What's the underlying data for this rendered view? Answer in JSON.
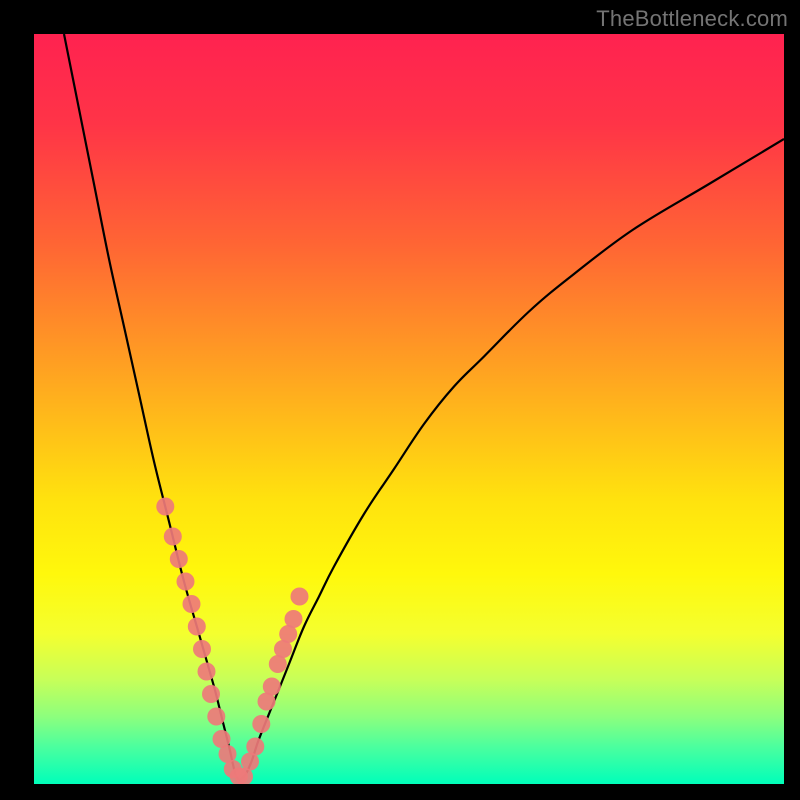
{
  "watermark": "TheBottleneck.com",
  "colors": {
    "frame": "#000000",
    "curve": "#000000",
    "point_fill": "#ee7a79",
    "gradient_stops": [
      {
        "offset": 0.0,
        "color": "#ff2250"
      },
      {
        "offset": 0.12,
        "color": "#ff3447"
      },
      {
        "offset": 0.28,
        "color": "#ff6534"
      },
      {
        "offset": 0.45,
        "color": "#ffa321"
      },
      {
        "offset": 0.62,
        "color": "#ffe20e"
      },
      {
        "offset": 0.72,
        "color": "#fff80c"
      },
      {
        "offset": 0.8,
        "color": "#f4ff2f"
      },
      {
        "offset": 0.86,
        "color": "#c8ff58"
      },
      {
        "offset": 0.91,
        "color": "#8dff7d"
      },
      {
        "offset": 0.95,
        "color": "#4cff9e"
      },
      {
        "offset": 1.0,
        "color": "#00ffba"
      }
    ]
  },
  "chart_data": {
    "type": "line",
    "title": "",
    "xlabel": "",
    "ylabel": "",
    "xlim": [
      0,
      100
    ],
    "ylim": [
      0,
      100
    ],
    "note": "Bottleneck-style V curve. y represents bottleneck percentage; minimum at x≈27 where y≈0.",
    "series": [
      {
        "name": "bottleneck-curve",
        "x": [
          4,
          6,
          8,
          10,
          12,
          14,
          16,
          18,
          20,
          22,
          24,
          25,
          26,
          27,
          28,
          29,
          30,
          32,
          34,
          36,
          38,
          40,
          44,
          48,
          52,
          56,
          60,
          66,
          72,
          80,
          90,
          100
        ],
        "y": [
          100,
          90,
          80,
          70,
          61,
          52,
          43,
          35,
          27,
          20,
          13,
          9,
          5,
          1,
          1,
          3,
          6,
          11,
          16,
          21,
          25,
          29,
          36,
          42,
          48,
          53,
          57,
          63,
          68,
          74,
          80,
          86
        ]
      }
    ],
    "scatter_points": {
      "name": "highlighted-points",
      "note": "Pink dots clustered along V near the trough",
      "x": [
        17.5,
        18.5,
        19.3,
        20.2,
        21.0,
        21.7,
        22.4,
        23.0,
        23.6,
        24.3,
        25.0,
        25.8,
        26.5,
        27.3,
        28.0,
        28.8,
        29.5,
        30.3,
        31.0,
        31.7,
        32.5,
        33.2,
        33.9,
        34.6,
        35.4
      ],
      "y": [
        37,
        33,
        30,
        27,
        24,
        21,
        18,
        15,
        12,
        9,
        6,
        4,
        2,
        1,
        1,
        3,
        5,
        8,
        11,
        13,
        16,
        18,
        20,
        22,
        25
      ]
    }
  }
}
